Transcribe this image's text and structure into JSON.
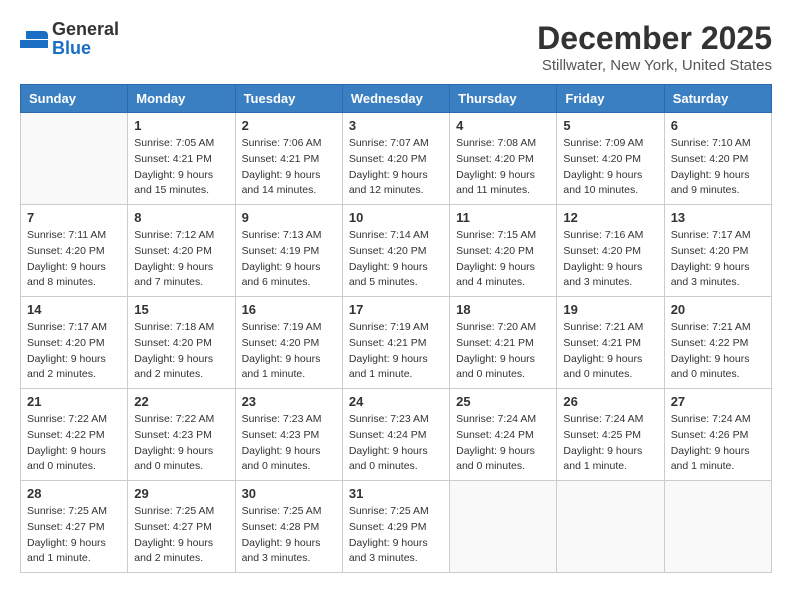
{
  "header": {
    "logo_general": "General",
    "logo_blue": "Blue",
    "month_title": "December 2025",
    "location": "Stillwater, New York, United States"
  },
  "calendar": {
    "days_of_week": [
      "Sunday",
      "Monday",
      "Tuesday",
      "Wednesday",
      "Thursday",
      "Friday",
      "Saturday"
    ],
    "weeks": [
      [
        {
          "day": "",
          "info": ""
        },
        {
          "day": "1",
          "info": "Sunrise: 7:05 AM\nSunset: 4:21 PM\nDaylight: 9 hours\nand 15 minutes."
        },
        {
          "day": "2",
          "info": "Sunrise: 7:06 AM\nSunset: 4:21 PM\nDaylight: 9 hours\nand 14 minutes."
        },
        {
          "day": "3",
          "info": "Sunrise: 7:07 AM\nSunset: 4:20 PM\nDaylight: 9 hours\nand 12 minutes."
        },
        {
          "day": "4",
          "info": "Sunrise: 7:08 AM\nSunset: 4:20 PM\nDaylight: 9 hours\nand 11 minutes."
        },
        {
          "day": "5",
          "info": "Sunrise: 7:09 AM\nSunset: 4:20 PM\nDaylight: 9 hours\nand 10 minutes."
        },
        {
          "day": "6",
          "info": "Sunrise: 7:10 AM\nSunset: 4:20 PM\nDaylight: 9 hours\nand 9 minutes."
        }
      ],
      [
        {
          "day": "7",
          "info": "Sunrise: 7:11 AM\nSunset: 4:20 PM\nDaylight: 9 hours\nand 8 minutes."
        },
        {
          "day": "8",
          "info": "Sunrise: 7:12 AM\nSunset: 4:20 PM\nDaylight: 9 hours\nand 7 minutes."
        },
        {
          "day": "9",
          "info": "Sunrise: 7:13 AM\nSunset: 4:19 PM\nDaylight: 9 hours\nand 6 minutes."
        },
        {
          "day": "10",
          "info": "Sunrise: 7:14 AM\nSunset: 4:20 PM\nDaylight: 9 hours\nand 5 minutes."
        },
        {
          "day": "11",
          "info": "Sunrise: 7:15 AM\nSunset: 4:20 PM\nDaylight: 9 hours\nand 4 minutes."
        },
        {
          "day": "12",
          "info": "Sunrise: 7:16 AM\nSunset: 4:20 PM\nDaylight: 9 hours\nand 3 minutes."
        },
        {
          "day": "13",
          "info": "Sunrise: 7:17 AM\nSunset: 4:20 PM\nDaylight: 9 hours\nand 3 minutes."
        }
      ],
      [
        {
          "day": "14",
          "info": "Sunrise: 7:17 AM\nSunset: 4:20 PM\nDaylight: 9 hours\nand 2 minutes."
        },
        {
          "day": "15",
          "info": "Sunrise: 7:18 AM\nSunset: 4:20 PM\nDaylight: 9 hours\nand 2 minutes."
        },
        {
          "day": "16",
          "info": "Sunrise: 7:19 AM\nSunset: 4:20 PM\nDaylight: 9 hours\nand 1 minute."
        },
        {
          "day": "17",
          "info": "Sunrise: 7:19 AM\nSunset: 4:21 PM\nDaylight: 9 hours\nand 1 minute."
        },
        {
          "day": "18",
          "info": "Sunrise: 7:20 AM\nSunset: 4:21 PM\nDaylight: 9 hours\nand 0 minutes."
        },
        {
          "day": "19",
          "info": "Sunrise: 7:21 AM\nSunset: 4:21 PM\nDaylight: 9 hours\nand 0 minutes."
        },
        {
          "day": "20",
          "info": "Sunrise: 7:21 AM\nSunset: 4:22 PM\nDaylight: 9 hours\nand 0 minutes."
        }
      ],
      [
        {
          "day": "21",
          "info": "Sunrise: 7:22 AM\nSunset: 4:22 PM\nDaylight: 9 hours\nand 0 minutes."
        },
        {
          "day": "22",
          "info": "Sunrise: 7:22 AM\nSunset: 4:23 PM\nDaylight: 9 hours\nand 0 minutes."
        },
        {
          "day": "23",
          "info": "Sunrise: 7:23 AM\nSunset: 4:23 PM\nDaylight: 9 hours\nand 0 minutes."
        },
        {
          "day": "24",
          "info": "Sunrise: 7:23 AM\nSunset: 4:24 PM\nDaylight: 9 hours\nand 0 minutes."
        },
        {
          "day": "25",
          "info": "Sunrise: 7:24 AM\nSunset: 4:24 PM\nDaylight: 9 hours\nand 0 minutes."
        },
        {
          "day": "26",
          "info": "Sunrise: 7:24 AM\nSunset: 4:25 PM\nDaylight: 9 hours\nand 1 minute."
        },
        {
          "day": "27",
          "info": "Sunrise: 7:24 AM\nSunset: 4:26 PM\nDaylight: 9 hours\nand 1 minute."
        }
      ],
      [
        {
          "day": "28",
          "info": "Sunrise: 7:25 AM\nSunset: 4:27 PM\nDaylight: 9 hours\nand 1 minute."
        },
        {
          "day": "29",
          "info": "Sunrise: 7:25 AM\nSunset: 4:27 PM\nDaylight: 9 hours\nand 2 minutes."
        },
        {
          "day": "30",
          "info": "Sunrise: 7:25 AM\nSunset: 4:28 PM\nDaylight: 9 hours\nand 3 minutes."
        },
        {
          "day": "31",
          "info": "Sunrise: 7:25 AM\nSunset: 4:29 PM\nDaylight: 9 hours\nand 3 minutes."
        },
        {
          "day": "",
          "info": ""
        },
        {
          "day": "",
          "info": ""
        },
        {
          "day": "",
          "info": ""
        }
      ]
    ]
  }
}
